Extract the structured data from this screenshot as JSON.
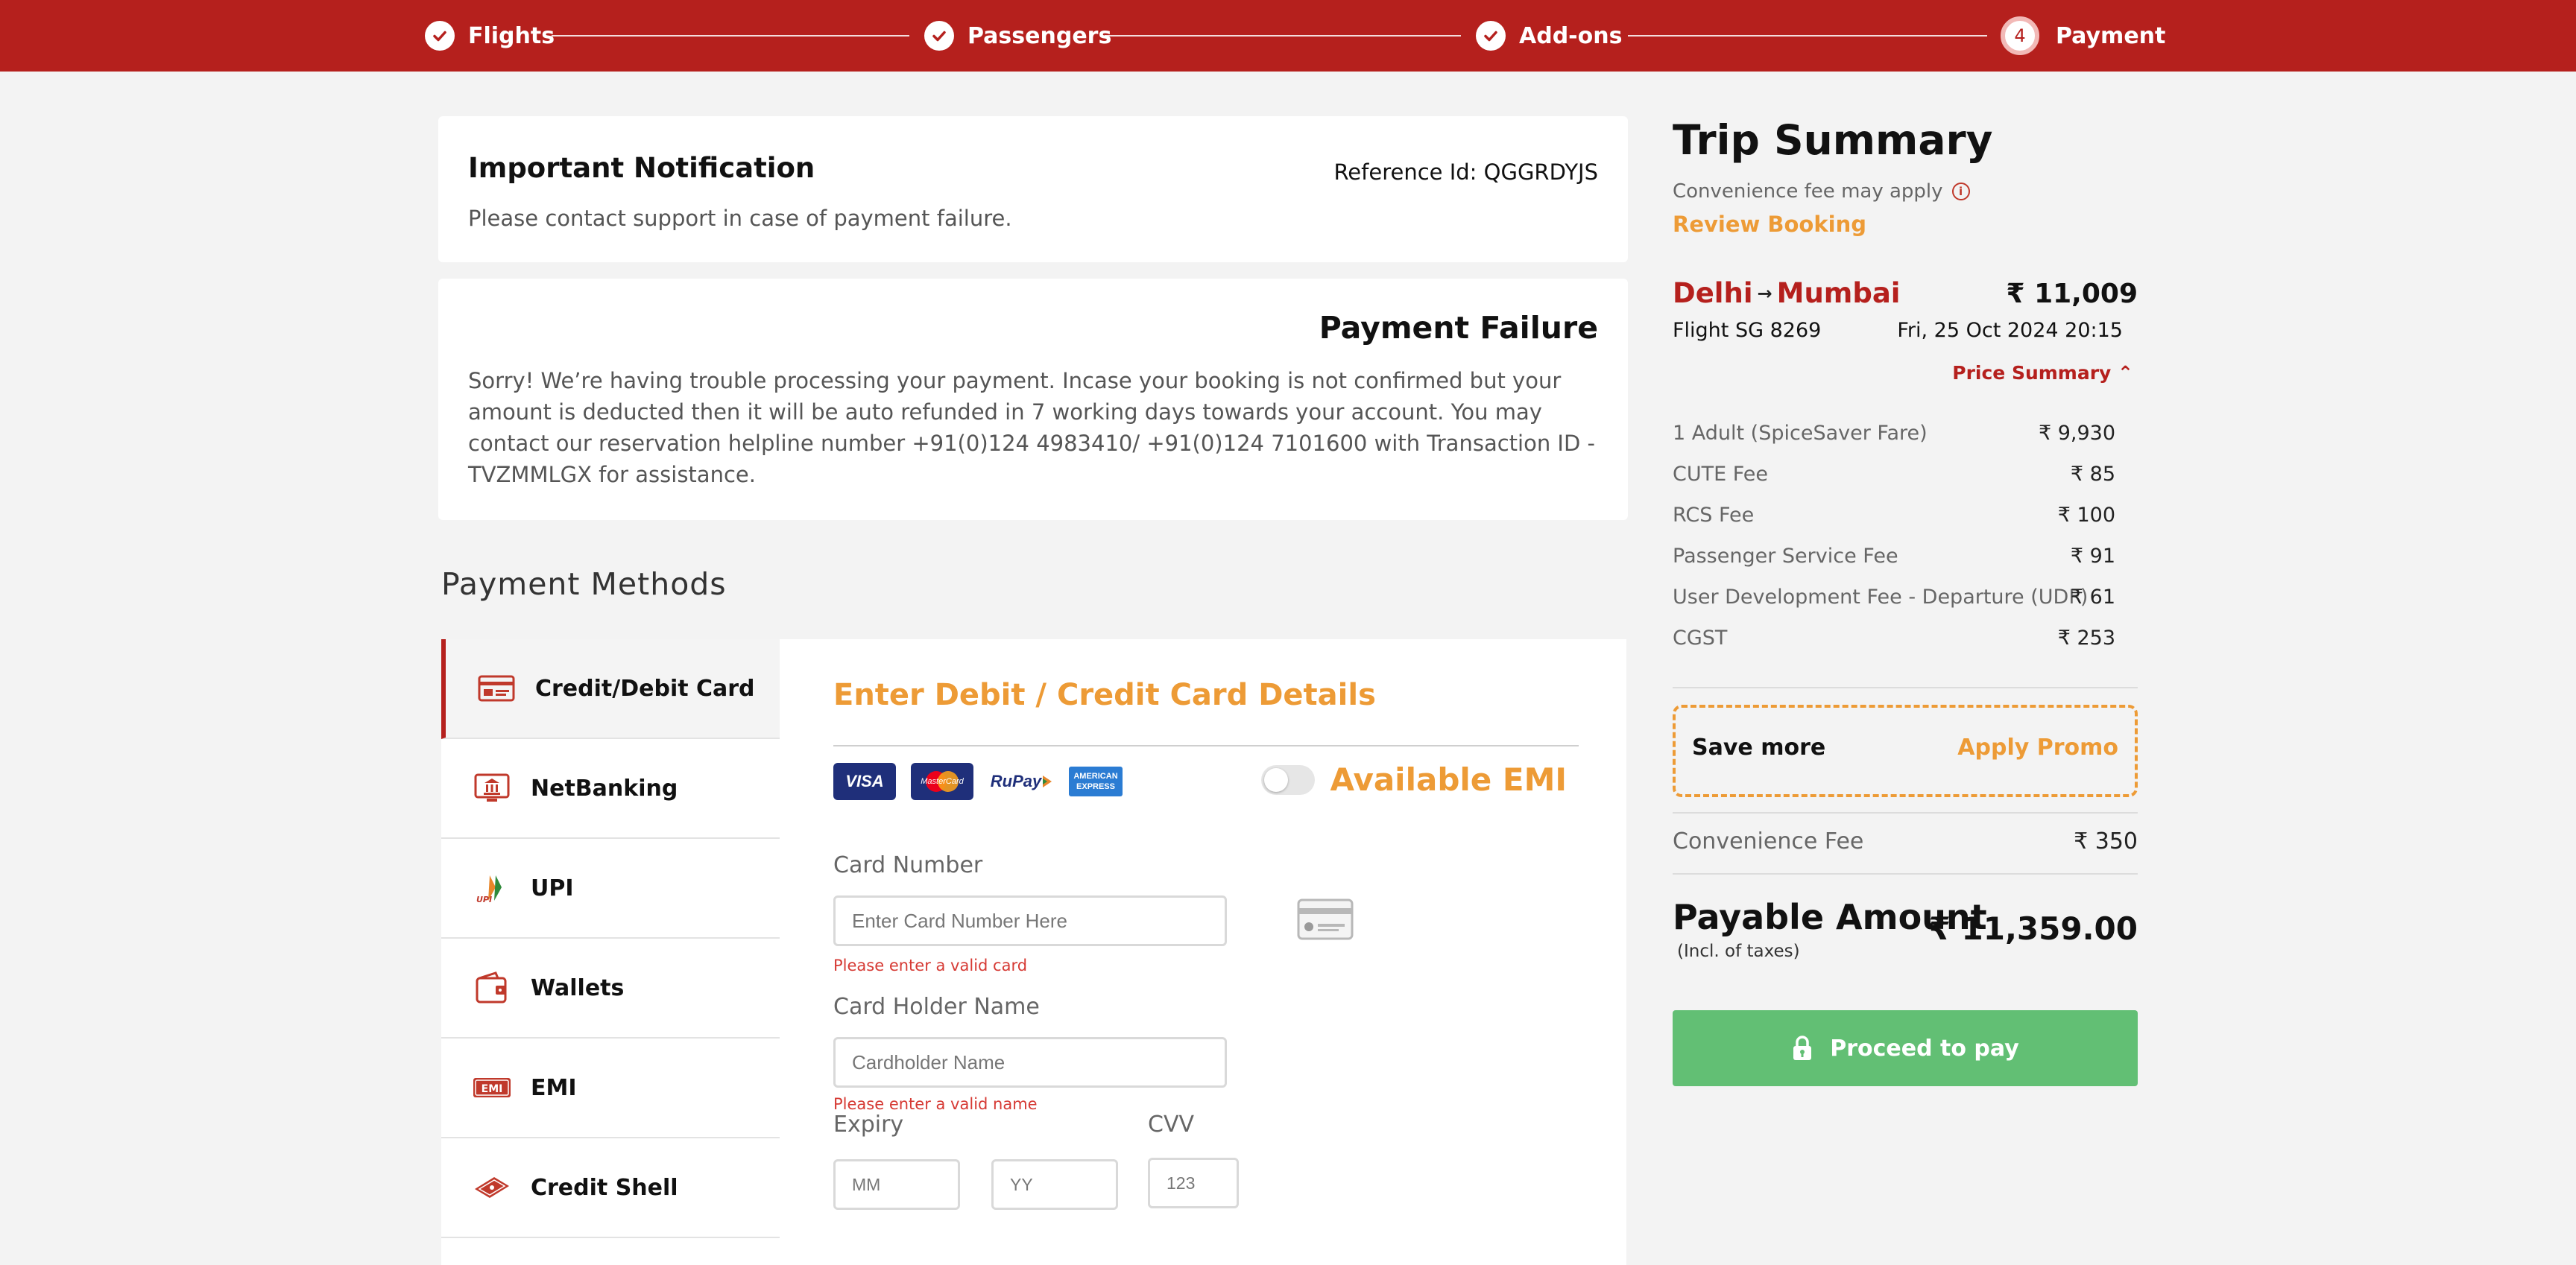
{
  "stepper": {
    "steps": [
      {
        "label": "Flights"
      },
      {
        "label": "Passengers"
      },
      {
        "label": "Add-ons"
      },
      {
        "label": "Payment",
        "number": "4"
      }
    ]
  },
  "notification": {
    "title": "Important Notification",
    "reference": "Reference Id: QGGRDYJS",
    "message": "Please contact support in case of payment failure."
  },
  "failure": {
    "title": "Payment Failure",
    "message": "Sorry! We’re having trouble processing your payment. Incase your booking is not confirmed but your amount is deducted then it will be auto refunded in 7 working days towards your account. You may contact our reservation helpline number +91(0)124 4983410/ +91(0)124 7101600  with Transaction ID - TVZMMLGX for assistance."
  },
  "payment_methods": {
    "title": "Payment Methods",
    "items": [
      {
        "label": "Credit/Debit Card",
        "icon": "card-icon",
        "active": true
      },
      {
        "label": "NetBanking",
        "icon": "bank-icon"
      },
      {
        "label": "UPI",
        "icon": "upi-icon"
      },
      {
        "label": "Wallets",
        "icon": "wallet-icon"
      },
      {
        "label": "EMI",
        "icon": "emi-icon"
      },
      {
        "label": "Credit Shell",
        "icon": "credit-shell-icon"
      }
    ]
  },
  "card_form": {
    "title": "Enter Debit / Credit Card Details",
    "logos": {
      "visa": "VISA",
      "mastercard": "MasterCard",
      "rupay": "RuPay",
      "amex_line1": "AMERICAN",
      "amex_line2": "EXPRESS"
    },
    "emi_label": "Available EMI",
    "card_number": {
      "label": "Card Number",
      "placeholder": "Enter Card Number Here",
      "error": "Please enter a valid card"
    },
    "holder_name": {
      "label": "Card Holder Name",
      "placeholder": "Cardholder Name",
      "error": "Please enter a valid name"
    },
    "expiry": {
      "label": "Expiry",
      "month_placeholder": "MM",
      "year_placeholder": "YY"
    },
    "cvv": {
      "label": "CVV",
      "placeholder": "123"
    }
  },
  "trip_summary": {
    "title": "Trip Summary",
    "convenience_note": "Convenience fee may apply",
    "review_link": "Review Booking",
    "origin": "Delhi",
    "arrow": "→",
    "destination": "Mumbai",
    "fare_total": "₹ 11,009",
    "flight_label": "Flight  SG 8269",
    "flight_datetime": "Fri, 25 Oct 2024  20:15",
    "price_summary_label": "Price Summary ⌃",
    "price_rows": [
      {
        "label": "1 Adult  (SpiceSaver Fare)",
        "value": "₹ 9,930"
      },
      {
        "label": "CUTE Fee",
        "value": "₹ 85"
      },
      {
        "label": "RCS Fee",
        "value": "₹ 100"
      },
      {
        "label": "Passenger Service Fee",
        "value": "₹ 91"
      },
      {
        "label": "User Development Fee - Departure (UDF)",
        "value": "₹ 61"
      },
      {
        "label": "CGST",
        "value": "₹ 253"
      }
    ],
    "promo": {
      "text": "Save more",
      "action": "Apply Promo"
    },
    "convenience_fee": {
      "label": "Convenience Fee",
      "value": "₹ 350"
    },
    "payable_label": "Payable Amount",
    "payable_note": "(Incl. of taxes)",
    "payable_amount": "₹ 11,359.00",
    "proceed_label": "Proceed to pay"
  },
  "colors": {
    "brand_red": "#b5201d",
    "accent_orange": "#ed9b36",
    "success_green": "#62bf74",
    "error_red": "#d63a34"
  }
}
